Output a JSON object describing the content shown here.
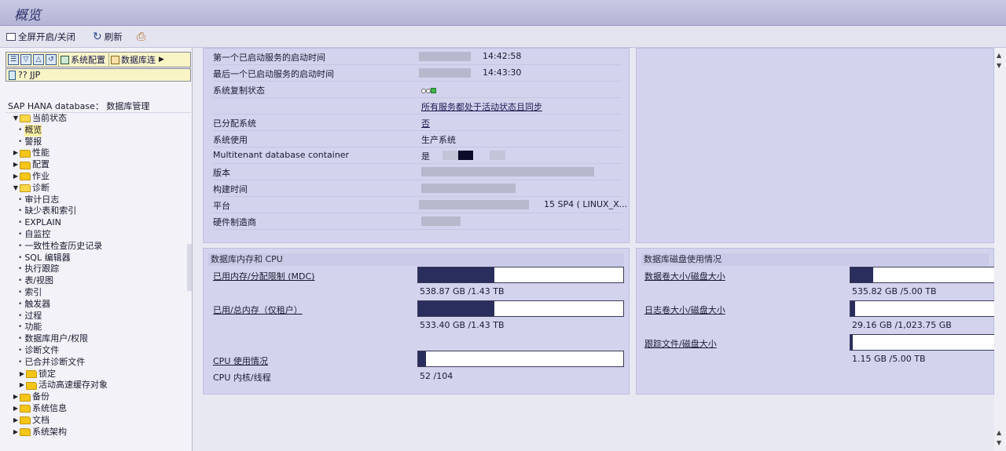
{
  "window": {
    "title": "概览"
  },
  "toolbar": {
    "fullscreen_label": "全屏开启/关闭",
    "refresh_label": "刷新"
  },
  "nav": {
    "toolbar_buttons": [
      "系统配置",
      "数据库连"
    ],
    "system_label": "?? JJP",
    "root_label": "SAP HANA database： 数据库管理",
    "tree": [
      {
        "label": "当前状态",
        "type": "folder-open",
        "indent": 0
      },
      {
        "label": "概览",
        "type": "leaf",
        "indent": 1,
        "selected": true
      },
      {
        "label": "警报",
        "type": "leaf",
        "indent": 1
      },
      {
        "label": "性能",
        "type": "folder",
        "indent": 0
      },
      {
        "label": "配置",
        "type": "folder",
        "indent": 0
      },
      {
        "label": "作业",
        "type": "folder",
        "indent": 0
      },
      {
        "label": "诊断",
        "type": "folder-open",
        "indent": 0
      },
      {
        "label": "审计日志",
        "type": "leaf",
        "indent": 1
      },
      {
        "label": "缺少表和索引",
        "type": "leaf",
        "indent": 1
      },
      {
        "label": "EXPLAIN",
        "type": "leaf",
        "indent": 1
      },
      {
        "label": "自监控",
        "type": "leaf",
        "indent": 1
      },
      {
        "label": "一致性检查历史记录",
        "type": "leaf",
        "indent": 1
      },
      {
        "label": "SQL 编辑器",
        "type": "leaf",
        "indent": 1
      },
      {
        "label": "执行跟踪",
        "type": "leaf",
        "indent": 1
      },
      {
        "label": "表/视图",
        "type": "leaf",
        "indent": 1
      },
      {
        "label": "索引",
        "type": "leaf",
        "indent": 1
      },
      {
        "label": "触发器",
        "type": "leaf",
        "indent": 1
      },
      {
        "label": "过程",
        "type": "leaf",
        "indent": 1
      },
      {
        "label": "功能",
        "type": "leaf",
        "indent": 1
      },
      {
        "label": "数据库用户/权限",
        "type": "leaf",
        "indent": 1
      },
      {
        "label": "诊断文件",
        "type": "leaf",
        "indent": 1
      },
      {
        "label": "已合并诊断文件",
        "type": "leaf",
        "indent": 1
      },
      {
        "label": "锁定",
        "type": "folder",
        "indent": 1
      },
      {
        "label": "活动高速缓存对象",
        "type": "folder",
        "indent": 1
      },
      {
        "label": "备份",
        "type": "folder",
        "indent": 0
      },
      {
        "label": "系统信息",
        "type": "folder",
        "indent": 0
      },
      {
        "label": "文档",
        "type": "folder",
        "indent": 0
      },
      {
        "label": "系统架构",
        "type": "folder",
        "indent": 0
      }
    ]
  },
  "overview": {
    "rows": {
      "first_service_start_label": "第一个已启动服务的启动时间",
      "first_service_start_time": "14:42:58",
      "last_service_start_label": "最后一个已启动服务的启动时间",
      "last_service_start_time": "14:43:30",
      "replication_label": "系统复制状态",
      "all_services_link": "所有服务都处于活动状态且同步",
      "distributed_label": "已分配系统",
      "distributed_value": "否",
      "usage_label": "系统使用",
      "usage_value": "生产系统",
      "mdc_label": "Multitenant database container",
      "mdc_value": "是",
      "version_label": "版本",
      "build_time_label": "构建时间",
      "platform_label": "平台",
      "platform_value": "15 SP4 ( LINUX_X...",
      "hardware_label": "硬件制造商"
    }
  },
  "memory_cpu": {
    "title": "数据库内存和 CPU",
    "used_memory_label": "已用内存/分配限制 (MDC)",
    "used_memory_value": "538.87 GB /1.43 TB",
    "used_memory_fraction": 0.37,
    "resident_label": "已用/总内存（仅租户）",
    "resident_value": "533.40 GB /1.43 TB",
    "resident_fraction": 0.37,
    "cpu_usage_label": "CPU 使用情况",
    "cpu_usage_fraction": 0.04,
    "cpu_cores_label": "CPU 内核/线程",
    "cpu_cores_value": "52 /104"
  },
  "disk": {
    "title": "数据库磁盘使用情况",
    "data_label": "数据卷大小/磁盘大小",
    "data_value": "535.82 GB /5.00 TB",
    "data_fraction": 0.16,
    "log_label": "日志卷大小/磁盘大小",
    "log_value": "29.16 GB /1,023.75 GB",
    "log_fraction": 0.03,
    "trace_label": "跟踪文件/磁盘大小",
    "trace_value": "1.15 GB /5.00 TB",
    "trace_fraction": 0.01
  },
  "colors": {
    "gauge_fill": "#2a2e5c",
    "panel_bg": "#d3d3ee",
    "title_bg": "#b4b4d6"
  }
}
